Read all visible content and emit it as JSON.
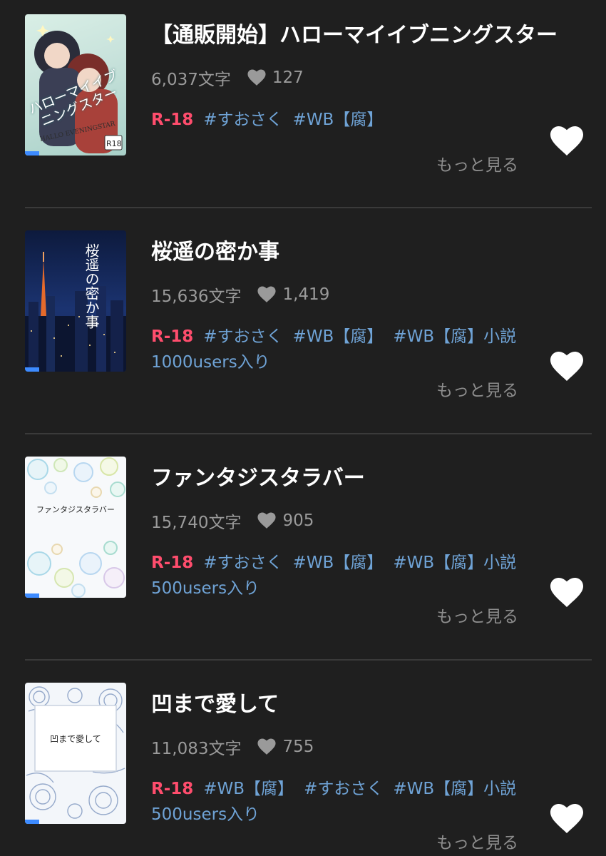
{
  "items": [
    {
      "title": "【通販開始】ハローマイイブニングスター",
      "char_count": "6,037文字",
      "likes": "127",
      "rating": "R-18",
      "tags": [
        "#すおさく",
        "#WB【腐】"
      ],
      "more_label": "もっと見る",
      "cover_text": "ハローマイイブニングスター",
      "cover_sub": "HALLO EVENINGSTAR",
      "cover_badge": "R18"
    },
    {
      "title": "桜遥の密か事",
      "char_count": "15,636文字",
      "likes": "1,419",
      "rating": "R-18",
      "tags": [
        "#すおさく",
        "#WB【腐】",
        "#WB【腐】小説1000users入り"
      ],
      "more_label": "もっと見る",
      "cover_text": "桜遥の密か事"
    },
    {
      "title": "ファンタジスタラバー",
      "char_count": "15,740文字",
      "likes": "905",
      "rating": "R-18",
      "tags": [
        "#すおさく",
        "#WB【腐】",
        "#WB【腐】小説500users入り"
      ],
      "more_label": "もっと見る",
      "cover_text": "ファンタジスタラバー"
    },
    {
      "title": "凹まで愛して",
      "char_count": "11,083文字",
      "likes": "755",
      "rating": "R-18",
      "tags": [
        "#WB【腐】",
        "#すおさく",
        "#WB【腐】小説500users入り"
      ],
      "more_label": "もっと見る",
      "cover_text": "凹まで愛して"
    }
  ],
  "colors": {
    "background": "#1f1f1f",
    "r18": "#ff4d6d",
    "tag": "#6fa3d6",
    "muted": "#9a9a9a",
    "progress": "#3d8bff"
  },
  "icons": {
    "stat_heart": "heart-icon",
    "like": "heart-filled-icon"
  }
}
